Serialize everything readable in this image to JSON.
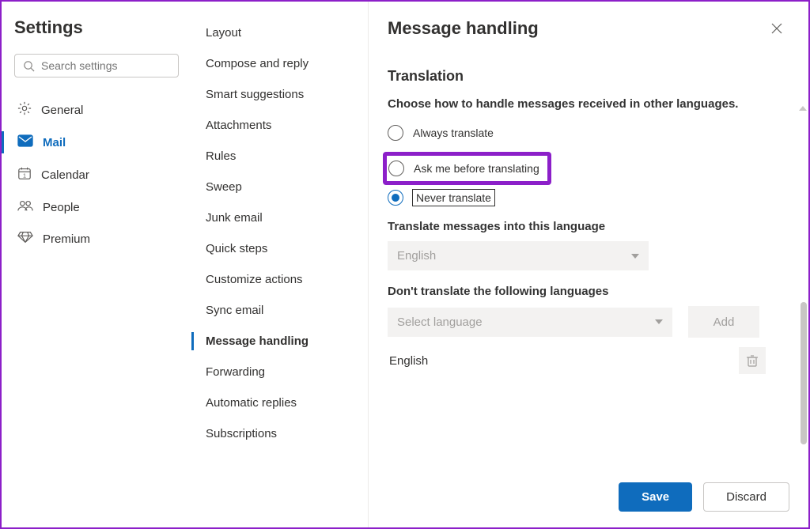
{
  "page_title": "Settings",
  "search": {
    "placeholder": "Search settings"
  },
  "categories": [
    {
      "id": "general",
      "label": "General",
      "icon": "gear"
    },
    {
      "id": "mail",
      "label": "Mail",
      "icon": "mail",
      "active": true
    },
    {
      "id": "calendar",
      "label": "Calendar",
      "icon": "calendar"
    },
    {
      "id": "people",
      "label": "People",
      "icon": "people"
    },
    {
      "id": "premium",
      "label": "Premium",
      "icon": "diamond"
    }
  ],
  "subnav": {
    "items": [
      "Layout",
      "Compose and reply",
      "Smart suggestions",
      "Attachments",
      "Rules",
      "Sweep",
      "Junk email",
      "Quick steps",
      "Customize actions",
      "Sync email",
      "Message handling",
      "Forwarding",
      "Automatic replies",
      "Subscriptions"
    ],
    "active_index": 10
  },
  "panel": {
    "title": "Message handling",
    "section_title": "Translation",
    "section_desc": "Choose how to handle messages received in other languages.",
    "radio_options": [
      "Always translate",
      "Ask me before translating",
      "Never translate"
    ],
    "radio_selected_index": 2,
    "radio_highlight_index": 1,
    "translate_into_label": "Translate messages into this language",
    "translate_into_value": "English",
    "dont_translate_label": "Don't translate the following languages",
    "select_language_placeholder": "Select language",
    "add_label": "Add",
    "excluded_languages": [
      "English"
    ]
  },
  "footer": {
    "save": "Save",
    "discard": "Discard"
  }
}
